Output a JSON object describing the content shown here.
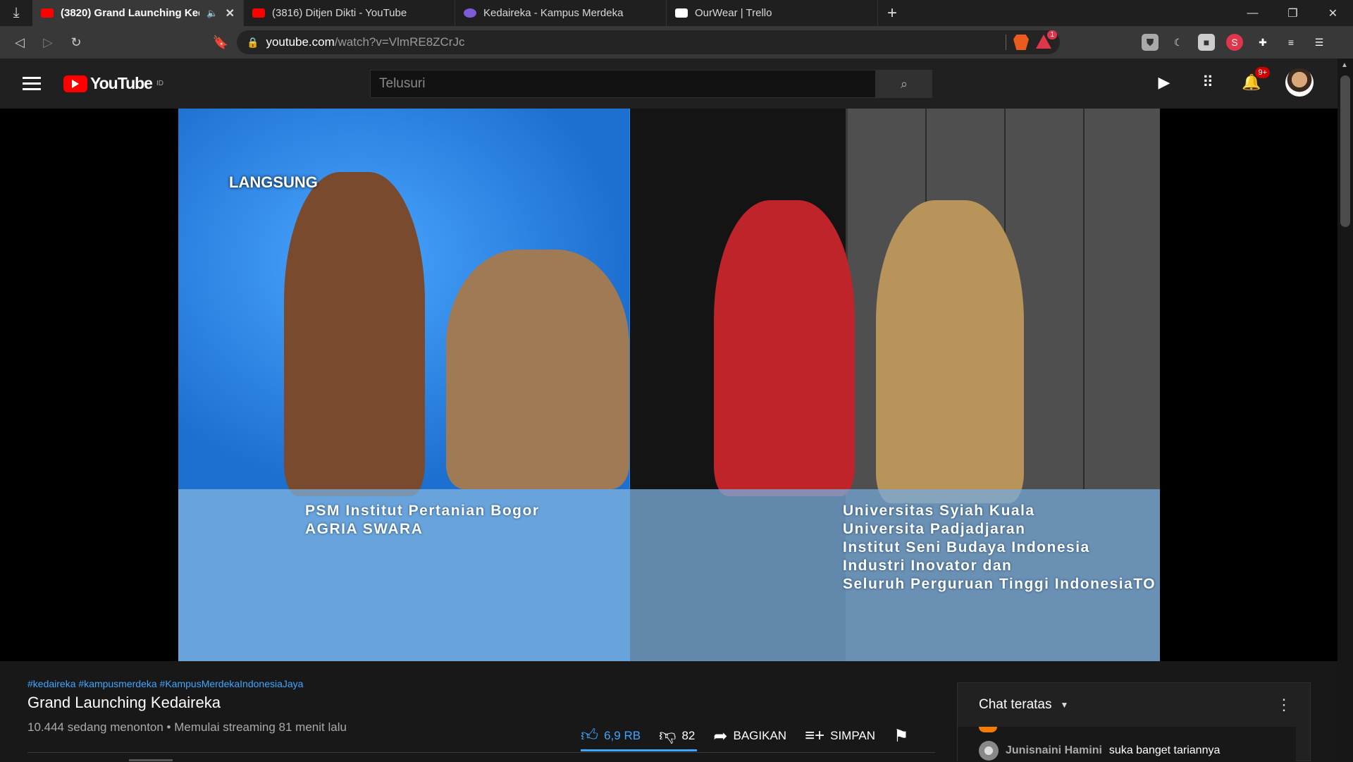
{
  "browser": {
    "download_icon": "download-icon",
    "tabs": [
      {
        "title": "(3820) Grand Launching Keda",
        "favicon_color": "#ff0000",
        "active": true,
        "has_speaker": true
      },
      {
        "title": "(3816) Ditjen Dikti - YouTube",
        "favicon_color": "#ff0000",
        "active": false,
        "has_speaker": false
      },
      {
        "title": "Kedaireka - Kampus Merdeka",
        "favicon_color": "#7c5cd6",
        "active": false,
        "has_speaker": false
      },
      {
        "title": "OurWear | Trello",
        "favicon_color": "#ffffff",
        "active": false,
        "has_speaker": false
      }
    ],
    "url_host": "youtube.com",
    "url_path": "/watch?v=VlmRE8ZCrJc",
    "rewards_badge": "1"
  },
  "youtube": {
    "logo_text": "YouTube",
    "logo_region": "ID",
    "search_placeholder": "Telusuri",
    "notification_badge": "9+"
  },
  "video": {
    "live_label": "LANGSUNG",
    "caption_left": [
      "PSM Institut Pertanian Bogor",
      "AGRIA SWARA"
    ],
    "caption_right": [
      "Universitas Syiah Kuala",
      "Universita Padjadjaran",
      "Institut Seni Budaya Indonesia",
      "Industri Inovator dan",
      "Seluruh Perguruan Tinggi IndonesiaTO"
    ]
  },
  "info": {
    "hashtags": "#kedaireka #kampusmerdeka #KampusMerdekaIndonesiaJaya",
    "title": "Grand Launching Kedaireka",
    "meta": "10.444 sedang menonton • Memulai streaming 81 menit lalu"
  },
  "actions": {
    "like_count": "6,9 RB",
    "dislike_count": "82",
    "share_label": "BAGIKAN",
    "save_label": "SIMPAN"
  },
  "chat": {
    "header": "Chat teratas",
    "message": {
      "author": "Junisnaini Hamini",
      "text": "suka banget tariannya"
    }
  },
  "colors": {
    "youtube_red": "#ff0000",
    "link_blue": "#3ea6ff",
    "chrome_dark": "#202020"
  }
}
